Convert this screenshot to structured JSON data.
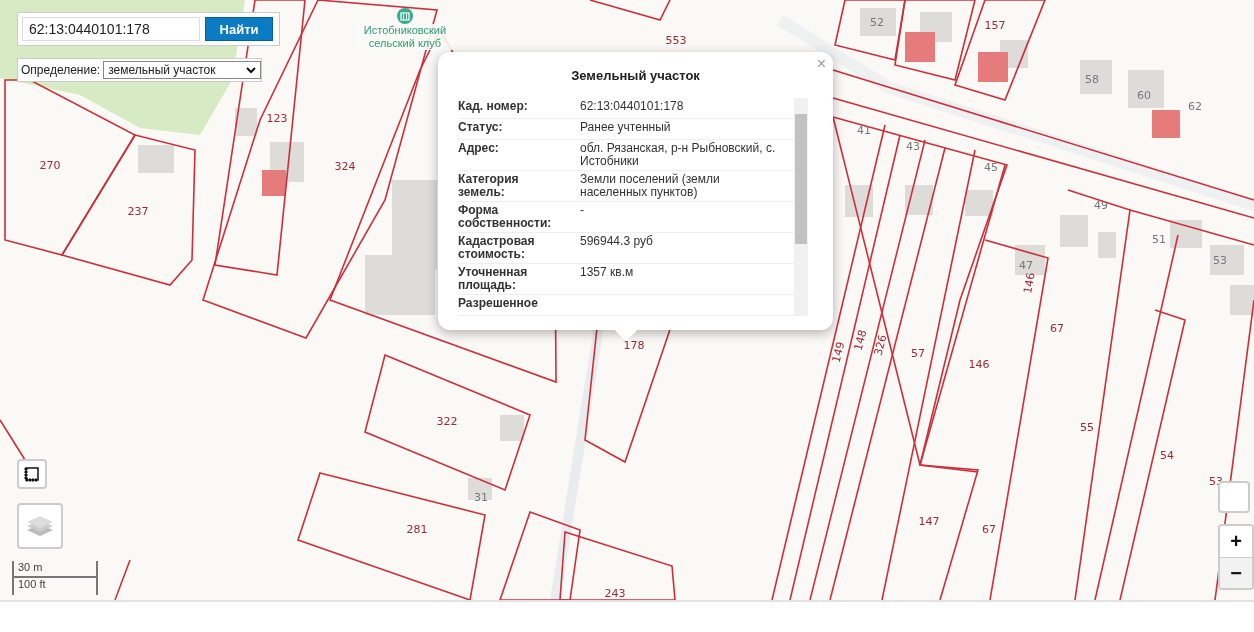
{
  "search": {
    "value": "62:13:0440101:178",
    "button": "Найти"
  },
  "definition": {
    "label": "Определение:",
    "value": "земельный участок"
  },
  "map": {
    "poi": {
      "name": "Истобниковский сельский клуб"
    },
    "labels": [
      "270",
      "237",
      "123",
      "324",
      "553",
      "52",
      "157",
      "58",
      "60",
      "62",
      "41",
      "43",
      "45",
      "49",
      "51",
      "47",
      "53",
      "146",
      "178",
      "149",
      "148",
      "326",
      "57",
      "146",
      "67",
      "322",
      "55",
      "54",
      "53",
      "31",
      "281",
      "147",
      "67",
      "243"
    ]
  },
  "popup": {
    "title": "Земельный участок",
    "close": "×",
    "rows": [
      {
        "label": "Кад. номер:",
        "value": "62:13:0440101:178"
      },
      {
        "label": "Статус:",
        "value": "Ранее учтенный"
      },
      {
        "label": "Адрес:",
        "value": "обл. Рязанская, р-н Рыбновский, с. Истобники"
      },
      {
        "label": "Категория земель:",
        "value": "Земли поселений (земли населенных пунктов)"
      },
      {
        "label": "Форма собственности:",
        "value": "-"
      },
      {
        "label": "Кадастровая стоимость:",
        "value": "596944.3 руб"
      },
      {
        "label": "Уточненная площадь:",
        "value": "1357 кв.м"
      },
      {
        "label": "Разрешенное"
      }
    ]
  },
  "zoom": {
    "in": "+",
    "out": "−"
  },
  "scale": {
    "metric": "30 m",
    "imperial": "100 ft"
  }
}
